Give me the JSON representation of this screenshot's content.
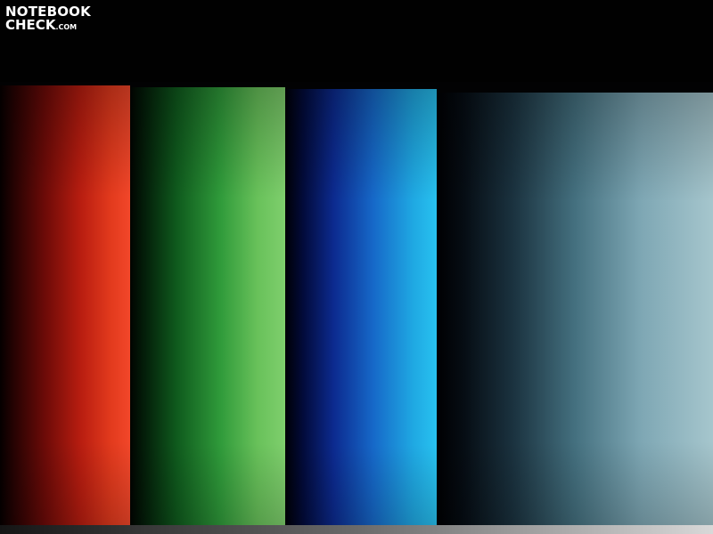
{
  "watermark": {
    "line1": "NOTEBOOK",
    "line2": "CHECK",
    "suffix": ".COM"
  },
  "colors": {
    "red_bar": "#f2472a",
    "green_bar": "#7fcf6d",
    "blue_bar": "#28c2f0",
    "gray_bar": "#a6c6cd",
    "background": "#010101"
  },
  "bars": [
    "red",
    "green",
    "blue",
    "gray"
  ]
}
